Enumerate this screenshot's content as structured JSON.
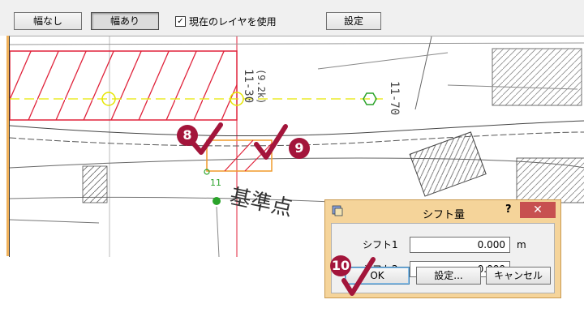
{
  "toolbar": {
    "btn_no_width": "幅なし",
    "btn_with_width": "幅あり",
    "use_layer_label": "現在のレイヤを使用",
    "use_layer_checked": true,
    "check_mark": "✓",
    "settings_label": "設定"
  },
  "map": {
    "point_label": "11",
    "benchmark_text": "基準点",
    "annot_top": "11-30",
    "annot_sub": "(9.2k)",
    "annot_right": "11-70"
  },
  "steps": [
    "8",
    "9",
    "10"
  ],
  "dialog": {
    "title": "シフト量",
    "help": "?",
    "close": "✕",
    "shift1_label": "シフト1",
    "shift1_value": "0.000",
    "shift2_label": "シフト2",
    "shift2_value": "0.000",
    "unit": "m",
    "ok_label": "OK",
    "settings_label": "設定...",
    "cancel_label": "キャンセル"
  },
  "colors": {
    "accent_badge": "#a3153b",
    "hatch_red": "#e0223a",
    "guide_yellow": "#e6e600",
    "point_green": "#2aa32a",
    "dialog_frame": "#f5d49a"
  }
}
